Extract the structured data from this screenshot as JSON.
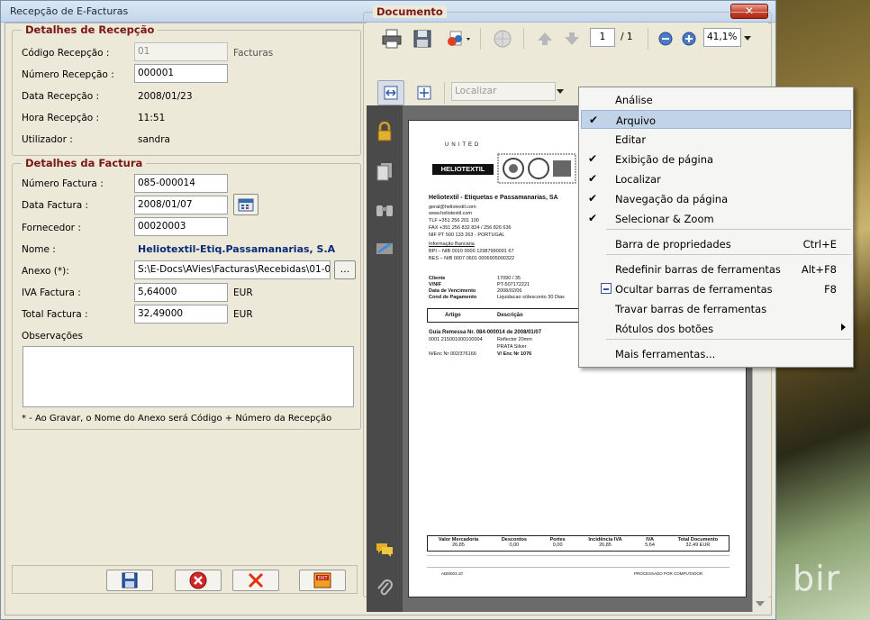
{
  "window": {
    "title": "Recepção de E-Facturas",
    "close_label": "✕"
  },
  "reception": {
    "title": "Detalhes de Recepção",
    "codigo_label": "Código Recepção :",
    "codigo_value": "01",
    "codigo_type": "Facturas",
    "numero_label": "Número Recepção :",
    "numero_value": "000001",
    "data_label": "Data Recepção :",
    "data_value": "2008/01/23",
    "hora_label": "Hora Recepção :",
    "hora_value": "11:51",
    "utilizador_label": "Utilizador :",
    "utilizador_value": "sandra"
  },
  "invoice": {
    "title": "Detalhes da Factura",
    "numero_label": "Número Factura :",
    "numero_value": "085-000014",
    "data_label": "Data Factura :",
    "data_value": "2008/01/07",
    "fornecedor_label": "Fornecedor :",
    "fornecedor_value": "00020003",
    "nome_label": "Nome :",
    "nome_value": "Heliotextil-Etiq.Passamanarias, S.A",
    "anexo_label": "Anexo (*):",
    "anexo_value": "S:\\E-Docs\\AVies\\Facturas\\Recebidas\\01-0",
    "anexo_browse": "...",
    "iva_label": "IVA Factura :",
    "iva_value": "5,64000",
    "iva_unit": "EUR",
    "total_label": "Total Factura :",
    "total_value": "32,49000",
    "total_unit": "EUR",
    "obs_label": "Observações",
    "footnote": "* - Ao Gravar, o Nome do Anexo será Código + Número da Recepção"
  },
  "document": {
    "title": "Documento",
    "page_current": "1",
    "page_total": "/ 1",
    "zoom": "41,1%",
    "search_placeholder": "Localizar"
  },
  "context_menu": {
    "items": [
      {
        "label": "Análise",
        "checked": false,
        "shortcut": ""
      },
      {
        "label": "Arquivo",
        "checked": true,
        "shortcut": ""
      },
      {
        "label": "Editar",
        "checked": false,
        "shortcut": ""
      },
      {
        "label": "Exibição de página",
        "checked": true,
        "shortcut": ""
      },
      {
        "label": "Localizar",
        "checked": true,
        "shortcut": ""
      },
      {
        "label": "Navegação da página",
        "checked": true,
        "shortcut": ""
      },
      {
        "label": "Selecionar & Zoom",
        "checked": true,
        "shortcut": ""
      },
      {
        "label": "Barra de propriedades",
        "checked": false,
        "shortcut": "Ctrl+E"
      },
      {
        "label": "Redefinir barras de ferramentas",
        "checked": false,
        "shortcut": "Alt+F8"
      },
      {
        "label": "Ocultar barras de ferramentas",
        "checked": false,
        "shortcut": "F8"
      },
      {
        "label": "Travar barras de ferramentas",
        "checked": false,
        "shortcut": ""
      },
      {
        "label": "Rótulos dos botões",
        "checked": false,
        "shortcut": ""
      },
      {
        "label": "Mais ferramentas...",
        "checked": false,
        "shortcut": ""
      }
    ],
    "check_mark": "✔"
  },
  "pdf": {
    "brand_top": "UNITED",
    "brand": "HELIOTEXTIL",
    "company": "Heliotextil - Etiquetas e Passamanarias, SA",
    "email": "geral@heliotextil.com",
    "web": "www.heliotextil.com",
    "tlf": "TLF  +351 256 201 100",
    "fax": "FAX  +351 256 832 824 / 256 826 636",
    "nif": "NIF  PT 500 133 263 - PORTUGAL",
    "bank_title": "Informação Bancária",
    "bank1": "BPI – NIB 0010 0000 12987990001 67",
    "bank2": "BES – NIB 0007 0601 0006905000322",
    "cliente_label": "Cliente",
    "cliente_value": "17090 / 35",
    "vnif_label": "V/NIF",
    "vnif_value": "PT-507172221",
    "venc_label": "Data de Vencimento",
    "venc_value": "2008/02/06",
    "cond_label": "Cond de Pagamento",
    "cond_value": "Liquidacao s/desconto 30 Dias",
    "col_artigo": "Artigo",
    "col_desc": "Descrição",
    "guia": "Guia Remessa Nr. 084-000014 de 2008/01/07",
    "line1a": "0001  215001000100004",
    "line1b": "Reflector 20mm",
    "line1c": "PRATA  Silver",
    "nenc": "N/Enc Nr 002/376166",
    "venc_nr": "V/ Enc Nr 1076",
    "tot_headers": [
      "Valor Mercadoria",
      "Descontos",
      "Portes",
      "Incidência IVA",
      "IVA",
      "Total Documento"
    ],
    "tot_values": [
      "26,85",
      "0,00",
      "0,00",
      "26,85",
      "5,64",
      "32,49 EUR"
    ],
    "foot_ref": "ADM003.10",
    "foot_proc": "PROCESSADO POR COMPUTADOR"
  },
  "desktop": {
    "text": "bir"
  }
}
